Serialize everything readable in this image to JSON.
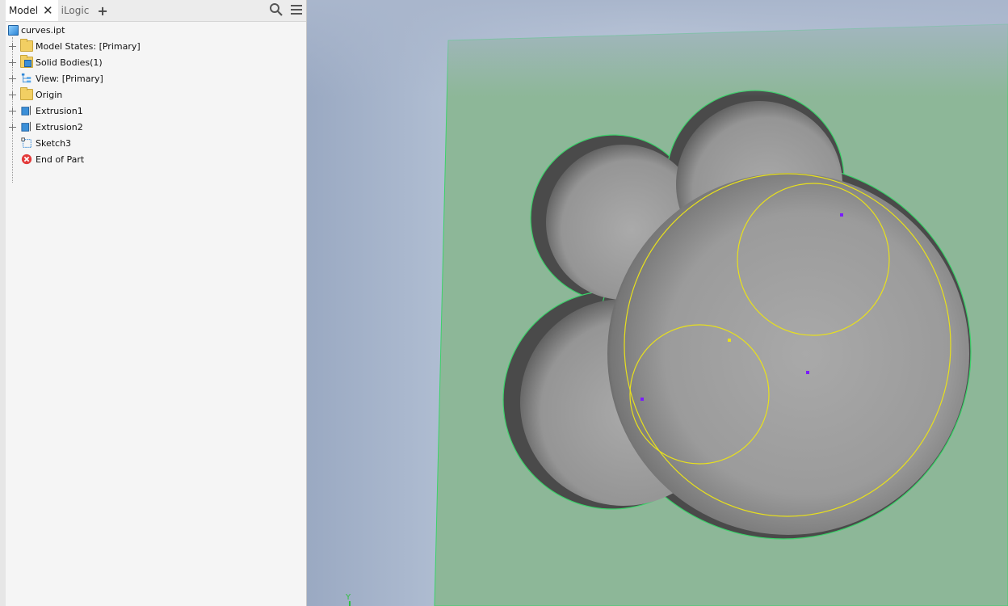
{
  "browser": {
    "tabs": [
      {
        "label": "Model",
        "active": true
      },
      {
        "label": "iLogic",
        "active": false
      }
    ],
    "add_tab_icon": "plus-icon",
    "search_icon": "search-icon",
    "menu_icon": "hamburger-menu-icon",
    "root": {
      "label": "curves.ipt",
      "icon": "part-icon"
    },
    "items": [
      {
        "label": "Model States: [Primary]",
        "icon": "folder-icon",
        "expandable": true
      },
      {
        "label": "Solid Bodies(1)",
        "icon": "solid-bodies-folder-icon",
        "expandable": true
      },
      {
        "label": "View: [Primary]",
        "icon": "view-rep-icon",
        "expandable": true
      },
      {
        "label": "Origin",
        "icon": "folder-icon",
        "expandable": true
      },
      {
        "label": "Extrusion1",
        "icon": "extrusion-icon",
        "expandable": true
      },
      {
        "label": "Extrusion2",
        "icon": "extrusion-icon",
        "expandable": true
      },
      {
        "label": "Sketch3",
        "icon": "sketch-icon",
        "expandable": false
      },
      {
        "label": "End of Part",
        "icon": "end-of-part-icon",
        "expandable": false
      }
    ]
  },
  "viewport": {
    "axis_label": "Y",
    "plate_color": "#8db798",
    "edge_color": "#3cd26a",
    "sketch_color": "#e8e01c",
    "point_color": "#7a1cff"
  }
}
